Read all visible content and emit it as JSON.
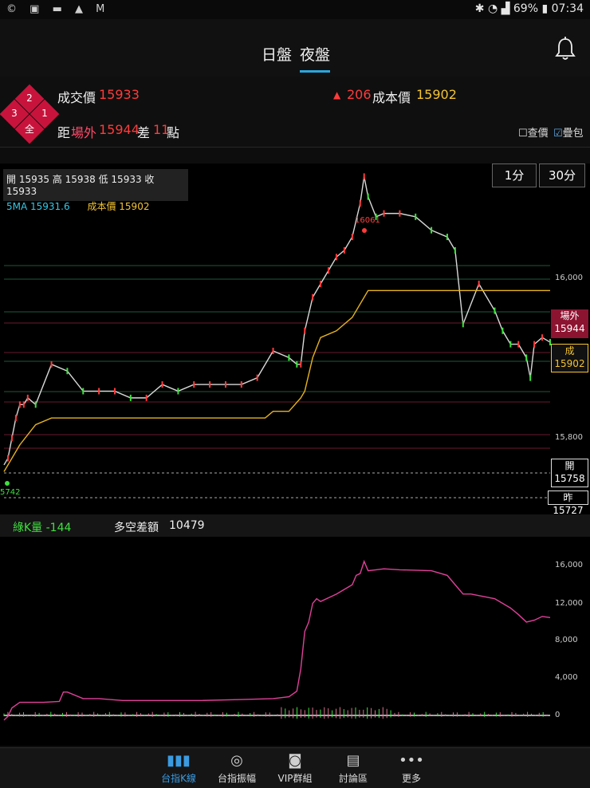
{
  "status_bar": {
    "left_icons": [
      "©",
      "▣",
      "▬",
      "▲",
      "M"
    ],
    "battery": "69%",
    "time": "07:34"
  },
  "header": {
    "tabs": [
      {
        "label": "日盤"
      },
      {
        "label": "夜盤"
      }
    ],
    "active_tab": "夜盤"
  },
  "quote": {
    "levels": [
      "2",
      "3",
      "1",
      "全"
    ],
    "trade_label": "成交價",
    "trade_price": "15933",
    "change_arrow": "▲",
    "change": "206",
    "cost_label": "成本價",
    "cost_price": "15902",
    "distance_label_prefix": "距",
    "distance_label_mid": "場外",
    "distance_value": "15944",
    "diff_label": "差",
    "diff_value": "11",
    "diff_unit": "點",
    "options": [
      {
        "label": "查價",
        "checked": false
      },
      {
        "label": "疊包",
        "checked": true
      }
    ]
  },
  "chart": {
    "ohlc_text": "開 15935 高 15938 低 15933 收 15933",
    "ma_label": "5MA 15931.6",
    "cost_label": "成本價 15902",
    "interval_buttons": [
      "1分",
      "30分"
    ],
    "high_label": "16061",
    "low_label": "5742",
    "y_ticks": [
      "16,000",
      "15,800"
    ],
    "tags": {
      "offsite": {
        "title": "場外",
        "value": "15944"
      },
      "cost": {
        "title": "成",
        "value": "15902"
      },
      "open": {
        "title": "開",
        "value": "15758"
      },
      "prev": {
        "title": "昨",
        "value": "15727"
      }
    }
  },
  "volume": {
    "green_label": "綠K量 -144",
    "spread_label": "多空差額",
    "spread_value": "10479",
    "y_ticks": [
      "16,000",
      "12,000",
      "8,000",
      "4,000",
      "0"
    ]
  },
  "nav": [
    {
      "label": "台指K線",
      "icon": "bar-chart-icon",
      "active": true
    },
    {
      "label": "台指振幅",
      "icon": "compass-icon",
      "active": false
    },
    {
      "label": "VIP群組",
      "icon": "chat-icon",
      "active": false
    },
    {
      "label": "討論區",
      "icon": "book-icon",
      "active": false
    },
    {
      "label": "更多",
      "icon": "more-icon",
      "active": false
    }
  ],
  "chart_data": [
    {
      "type": "line",
      "title": "",
      "series": [
        {
          "x": [
            0,
            5,
            10,
            15,
            20,
            25,
            30,
            40,
            60,
            80,
            100,
            120,
            140,
            160,
            180,
            200,
            220,
            240,
            260,
            280,
            300,
            320,
            340,
            360,
            370,
            375,
            380,
            390,
            400,
            410,
            420,
            430,
            440,
            450,
            455,
            460,
            470,
            480,
            500,
            520,
            540,
            560,
            570,
            580,
            600,
            620,
            630,
            640,
            650,
            660,
            665,
            670,
            680,
            690
          ],
          "y": [
            15750,
            15760,
            15790,
            15820,
            15840,
            15840,
            15850,
            15840,
            15900,
            15890,
            15860,
            15860,
            15860,
            15850,
            15850,
            15870,
            15860,
            15870,
            15870,
            15870,
            15870,
            15880,
            15920,
            15910,
            15900,
            15900,
            15950,
            16000,
            16020,
            16040,
            16060,
            16070,
            16090,
            16140,
            16180,
            16150,
            16120,
            16125,
            16125,
            16120,
            16100,
            16090,
            16070,
            15960,
            16020,
            15980,
            15950,
            15930,
            15930,
            15910,
            15880,
            15930,
            15940,
            15933
          ]
        },
        {
          "name": "成本價",
          "x": [
            0,
            20,
            40,
            60,
            80,
            100,
            200,
            300,
            330,
            340,
            360,
            375,
            380,
            390,
            400,
            420,
            440,
            455,
            460,
            690
          ],
          "y": [
            15740,
            15780,
            15810,
            15820,
            15820,
            15820,
            15820,
            15820,
            15820,
            15830,
            15830,
            15850,
            15860,
            15910,
            15940,
            15950,
            15970,
            16000,
            16010,
            16010
          ]
        }
      ]
    },
    {
      "type": "line",
      "title": "",
      "ylim": [
        -1000,
        17000
      ],
      "series": [
        {
          "name": "多空差額",
          "x": [
            0,
            5,
            10,
            20,
            30,
            50,
            70,
            75,
            80,
            100,
            120,
            150,
            200,
            250,
            300,
            340,
            360,
            370,
            375,
            380,
            385,
            390,
            395,
            400,
            420,
            430,
            440,
            445,
            450,
            455,
            460,
            470,
            480,
            500,
            540,
            560,
            570,
            580,
            590,
            620,
            630,
            640,
            650,
            660,
            670,
            680,
            690
          ],
          "y": [
            -500,
            -100,
            800,
            1400,
            1400,
            1400,
            1500,
            2500,
            2500,
            1800,
            1800,
            1600,
            1600,
            1600,
            1700,
            1800,
            2000,
            2600,
            5000,
            9000,
            10000,
            12000,
            12500,
            12200,
            13000,
            13500,
            14000,
            15000,
            15200,
            16500,
            15500,
            15600,
            15700,
            15600,
            15500,
            15000,
            14000,
            13000,
            13000,
            12500,
            12000,
            11500,
            10800,
            10000,
            10200,
            10600,
            10479
          ]
        }
      ]
    }
  ]
}
